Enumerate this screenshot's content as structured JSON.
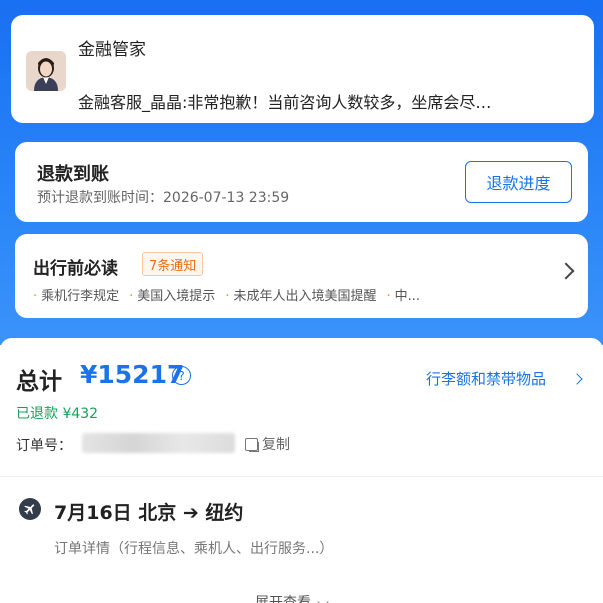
{
  "notification": {
    "title": "金融管家",
    "message": "金融客服_晶晶:非常抱歉！当前咨询人数较多，坐席会尽…"
  },
  "refund": {
    "title": "退款到账",
    "estimated_time": "预计退款到账时间：2026-07-13 23:59",
    "progress_button": "退款进度"
  },
  "travel_notice": {
    "title": "出行前必读",
    "badge": "7条通知",
    "items": [
      "乘机行李规定",
      "美国入境提示",
      "未成年人出入境美国提醒",
      "中..."
    ]
  },
  "order": {
    "total_label": "总计",
    "total_amount": "¥15217",
    "help_icon": "?",
    "luggage_link": "行李额和禁带物品",
    "refunded": "已退款 ¥432",
    "order_no_label": "订单号：",
    "copy_label": "复制",
    "flight_route": "7月16日 北京 ➔ 纽约",
    "order_details": "订单详情（行程信息、乘机人、出行服务...）",
    "expand_label": "展开查看"
  },
  "colors": {
    "accent": "#1a73e8",
    "header_bg": "#1a6ff2",
    "refund_green": "#18a058",
    "badge_orange": "#f06c12"
  }
}
